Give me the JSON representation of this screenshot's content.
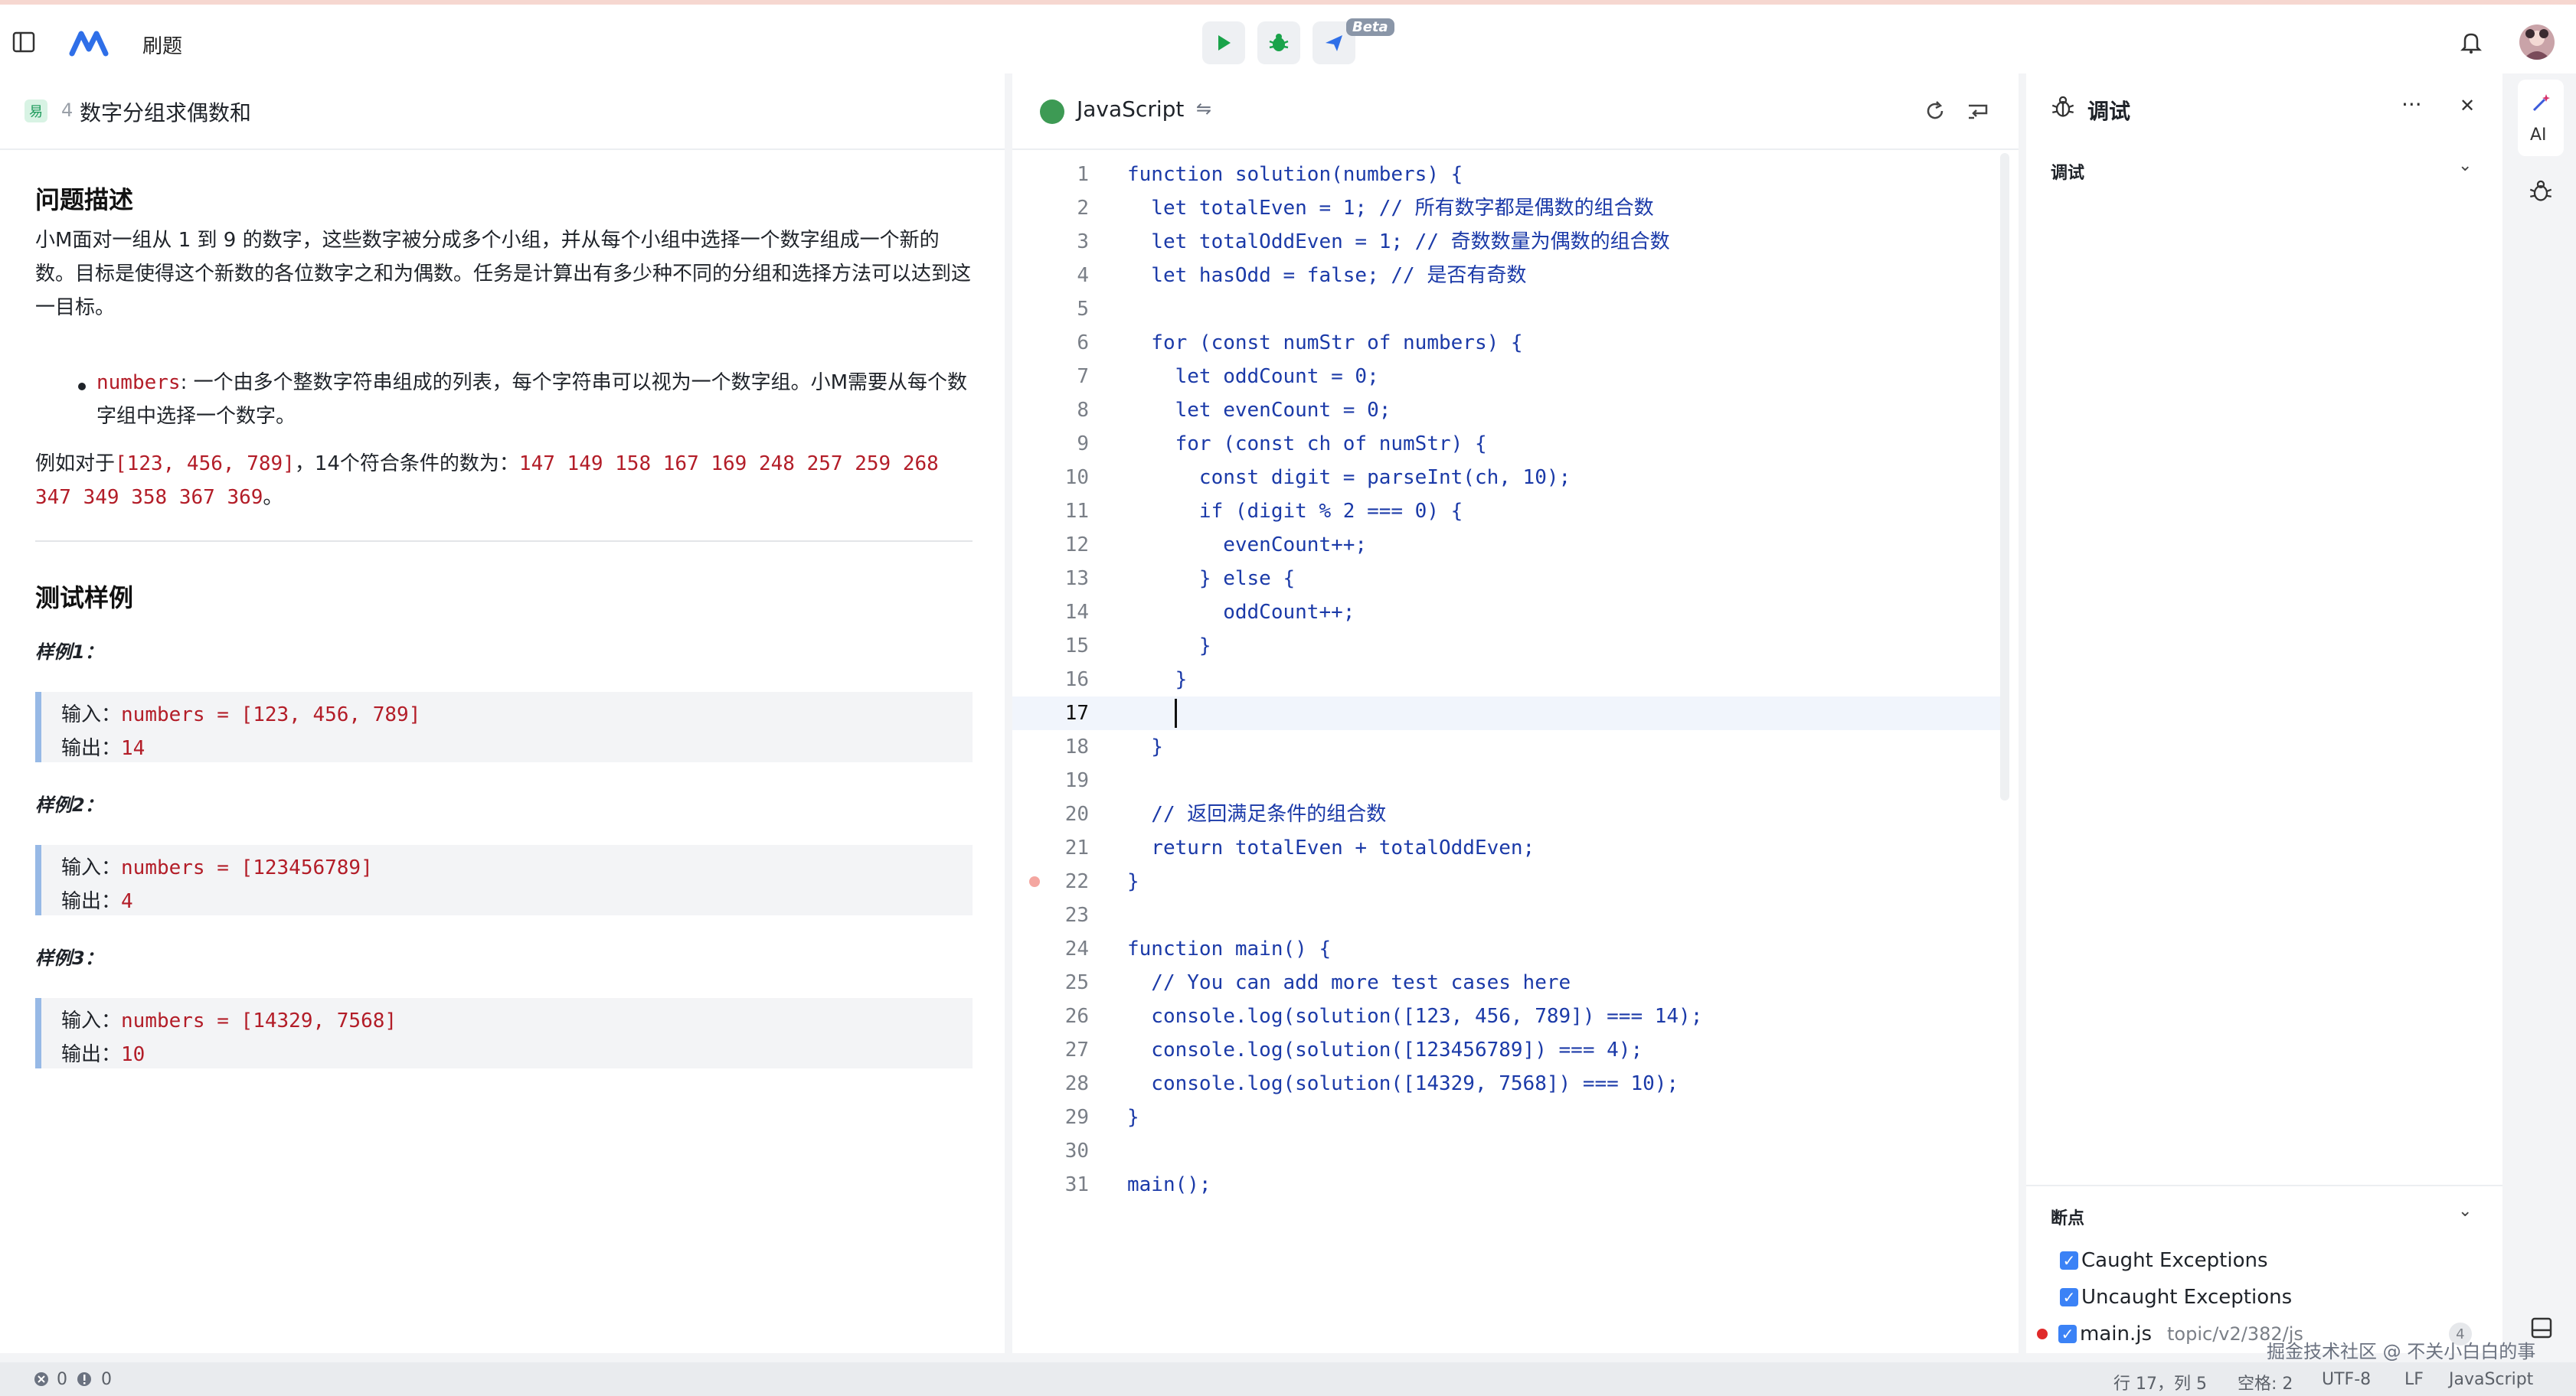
{
  "app": {
    "title": "刷题"
  },
  "toolbar": {
    "beta": "Beta"
  },
  "problem": {
    "difficulty": "易",
    "number": "4",
    "title": "数字分组求偶数和",
    "desc_heading": "问题描述",
    "desc_para": "小M面对一组从 1 到 9 的数字，这些数字被分成多个小组，并从每个小组中选择一个数字组成一个新的数。目标是使得这个新数的各位数字之和为偶数。任务是计算出有多少种不同的分组和选择方法可以达到这一目标。",
    "bullet_code": "numbers",
    "bullet_text": ": 一个由多个整数字符串组成的列表，每个字符串可以视为一个数字组。小M需要从每个数字组中选择一个数字。",
    "example_prefix": "例如对于",
    "example_input": "[123, 456, 789]",
    "example_mid": "，14个符合条件的数为：",
    "example_list": "147 149 158 167 169 248 257 259 268 347 349 358 367 369",
    "example_end": "。",
    "tests_heading": "测试样例",
    "samples": [
      {
        "label": "样例1：",
        "input_label": "输入：",
        "input": "numbers = [123, 456, 789]",
        "output_label": "输出：",
        "output": "14"
      },
      {
        "label": "样例2：",
        "input_label": "输入：",
        "input": "numbers = [123456789]",
        "output_label": "输出：",
        "output": "4"
      },
      {
        "label": "样例3：",
        "input_label": "输入：",
        "input": "numbers = [14329, 7568]",
        "output_label": "输出：",
        "output": "10"
      }
    ]
  },
  "editor": {
    "language": "JavaScript",
    "swap": "⇋",
    "active_line": 17,
    "breakpoint_line": 22,
    "lines": [
      "function solution(numbers) {",
      "  let totalEven = 1; // 所有数字都是偶数的组合数",
      "  let totalOddEven = 1; // 奇数数量为偶数的组合数",
      "  let hasOdd = false; // 是否有奇数",
      "",
      "  for (const numStr of numbers) {",
      "    let oddCount = 0;",
      "    let evenCount = 0;",
      "    for (const ch of numStr) {",
      "      const digit = parseInt(ch, 10);",
      "      if (digit % 2 === 0) {",
      "        evenCount++;",
      "      } else {",
      "        oddCount++;",
      "      }",
      "    }",
      "",
      "  }",
      "",
      "  // 返回满足条件的组合数",
      "  return totalEven + totalOddEven;",
      "}",
      "",
      "function main() {",
      "  // You can add more test cases here",
      "  console.log(solution([123, 456, 789]) === 14);",
      "  console.log(solution([123456789]) === 4);",
      "  console.log(solution([14329, 7568]) === 10);",
      "}",
      "",
      "main();"
    ]
  },
  "debug": {
    "title": "调试",
    "section": "调试",
    "breakpoints_title": "断点",
    "caught": "Caught Exceptions",
    "uncaught": "Uncaught Exceptions",
    "file": "main.js",
    "file_path": "topic/v2/382/js",
    "file_count": "4",
    "more": "···",
    "close": "✕"
  },
  "rail": {
    "ai": "AI"
  },
  "status": {
    "errors": "0",
    "warnings": "0",
    "position": "行 17，列 5",
    "spaces": "空格: 2",
    "encoding": "UTF-8",
    "eol": "LF",
    "language": "JavaScript",
    "watermark": "掘金技术社区 @ 不关小白白的事"
  }
}
